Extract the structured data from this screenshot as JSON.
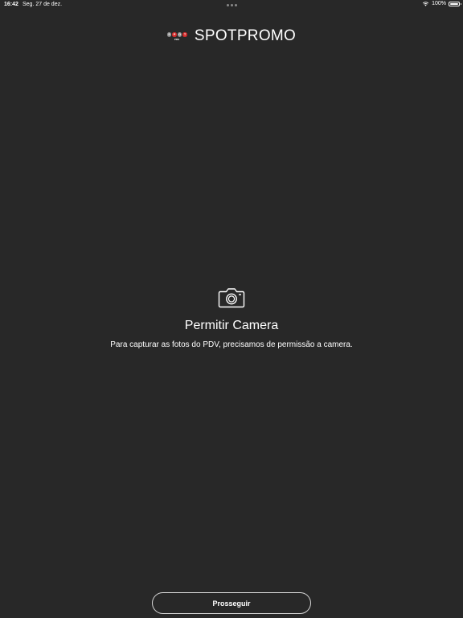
{
  "status_bar": {
    "time": "16:42",
    "date": "Seg. 27 de dez.",
    "battery": "100%",
    "battery_level": 1.0
  },
  "header": {
    "logo_letters": [
      "S",
      "P",
      "O",
      "T"
    ],
    "logo_colors": [
      "#8e8e8e",
      "#d22b2b",
      "#8e8e8e",
      "#d22b2b"
    ],
    "logo_subtext": "PDS",
    "title": "SPOTPROMO"
  },
  "permission": {
    "icon": "camera-icon",
    "title": "Permitir Camera",
    "description": "Para capturar as fotos do PDV, precisamos de permissão a camera."
  },
  "actions": {
    "continue_label": "Prosseguir"
  }
}
